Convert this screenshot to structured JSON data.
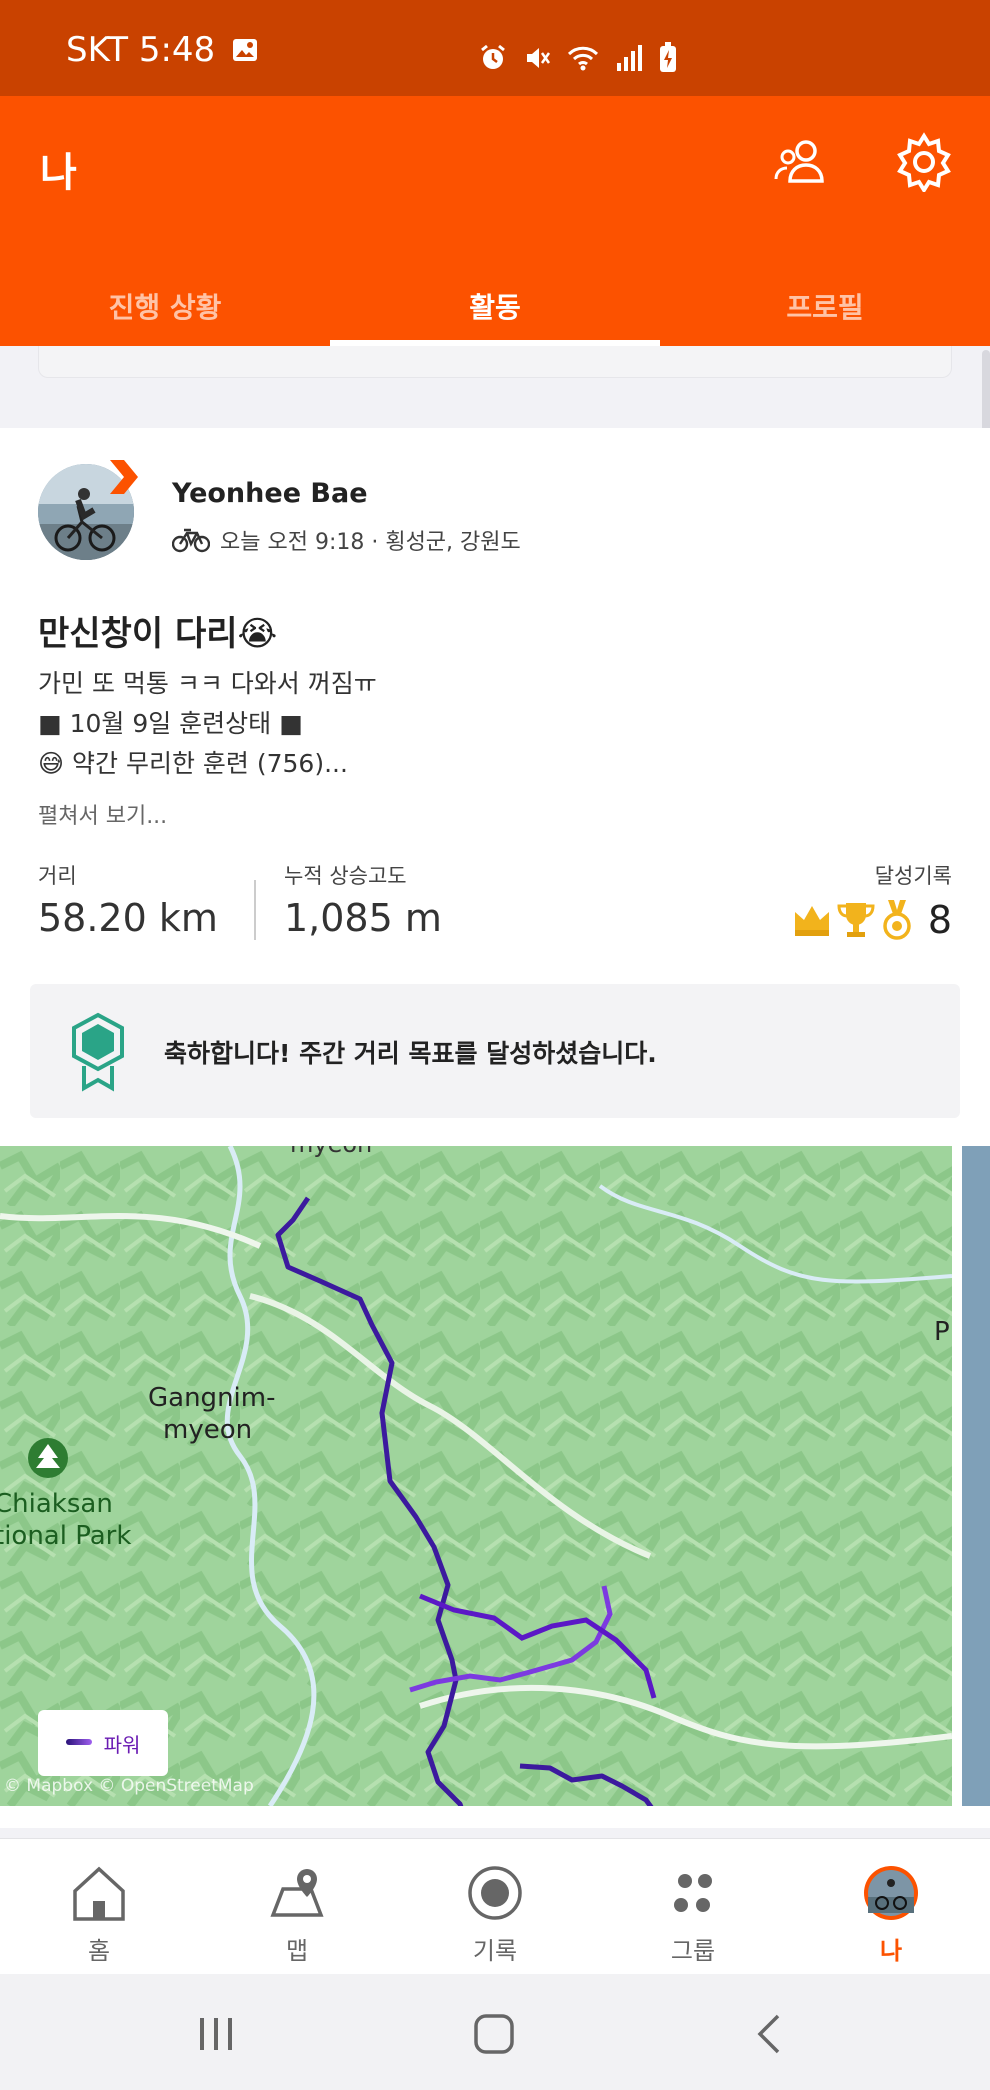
{
  "status_bar": {
    "carrier_time": "SKT 5:48"
  },
  "header": {
    "title": "나"
  },
  "tabs": [
    {
      "label": "진행 상황",
      "active": false
    },
    {
      "label": "활동",
      "active": true
    },
    {
      "label": "프로필",
      "active": false
    }
  ],
  "activity": {
    "athlete_name": "Yeonhee Bae",
    "meta": "오늘 오전 9:18 · 횡성군, 강원도",
    "title": "만신창이 다리😭",
    "description": [
      "가민 또 먹통 ㅋㅋ 다와서 꺼짐ㅠ",
      "■ 10월 9일 훈련상태 ■",
      "😅 약간 무리한 훈련 (756)..."
    ],
    "more_label": "펼쳐서 보기...",
    "stats": {
      "distance_label": "거리",
      "distance_value": "58.20 km",
      "elevation_label": "누적 상승고도",
      "elevation_value": "1,085 m",
      "achievements_label": "달성기록",
      "achievements_count": "8"
    },
    "goal_message": "축하합니다! 주간 거리 목표를 달성하셨습니다."
  },
  "map": {
    "labels": {
      "top": "myeon",
      "town_line1": "Gangnim-",
      "town_line2": "myeon",
      "park_line1": "Chiaksan",
      "park_line2": "tional Park",
      "edge": "P"
    },
    "legend_label": "파워",
    "attribution": "© Mapbox © OpenStreetMap"
  },
  "bottom_nav": [
    {
      "label": "홈",
      "icon": "home-icon",
      "active": false
    },
    {
      "label": "맵",
      "icon": "map-icon",
      "active": false
    },
    {
      "label": "기록",
      "icon": "record-icon",
      "active": false
    },
    {
      "label": "그룹",
      "icon": "groups-icon",
      "active": false
    },
    {
      "label": "나",
      "icon": "avatar-icon",
      "active": true
    }
  ],
  "colors": {
    "brand": "#fc5200",
    "status_bar": "#c94200",
    "route": "#5b18c6",
    "map_base": "#9fd49c"
  }
}
